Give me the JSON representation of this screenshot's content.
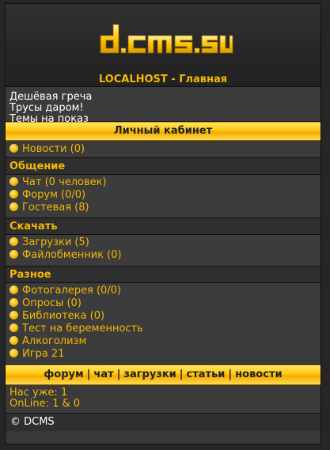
{
  "header": {
    "logo_text": "dcms.su",
    "title": "LOCALHOST - Главная"
  },
  "news_lines": [
    "Дешёвая греча",
    "Трусы даром!",
    "Темы на показ"
  ],
  "cabinet_label": "Личный кабинет",
  "menu_top": [
    {
      "label": "Новости (0)"
    }
  ],
  "sections": [
    {
      "title": "Общение",
      "items": [
        {
          "label": "Чат (0 человек)"
        },
        {
          "label": "Форум (0/0)"
        },
        {
          "label": "Гостевая (8)"
        }
      ]
    },
    {
      "title": "Скачать",
      "items": [
        {
          "label": "Загрузки (5)"
        },
        {
          "label": "Файлобменник (0)"
        }
      ]
    },
    {
      "title": "Разное",
      "items": [
        {
          "label": "Фотогалерея (0/0)"
        },
        {
          "label": "Опросы (0)"
        },
        {
          "label": "Библиотека (0)"
        },
        {
          "label": "Тест на беременность"
        },
        {
          "label": "Алкоголизм"
        },
        {
          "label": "Игра 21"
        }
      ]
    }
  ],
  "bottom_links": [
    "форум",
    "чат",
    "загрузки",
    "статьи",
    "новости"
  ],
  "bottom_separator": "|",
  "stats": {
    "users": "Нас уже: 1",
    "online": "OnLine: 1 & 0"
  },
  "footer": "© DCMS",
  "colors": {
    "accent": "#f5b800",
    "background": "#262626",
    "panel": "#3b3b3b"
  }
}
